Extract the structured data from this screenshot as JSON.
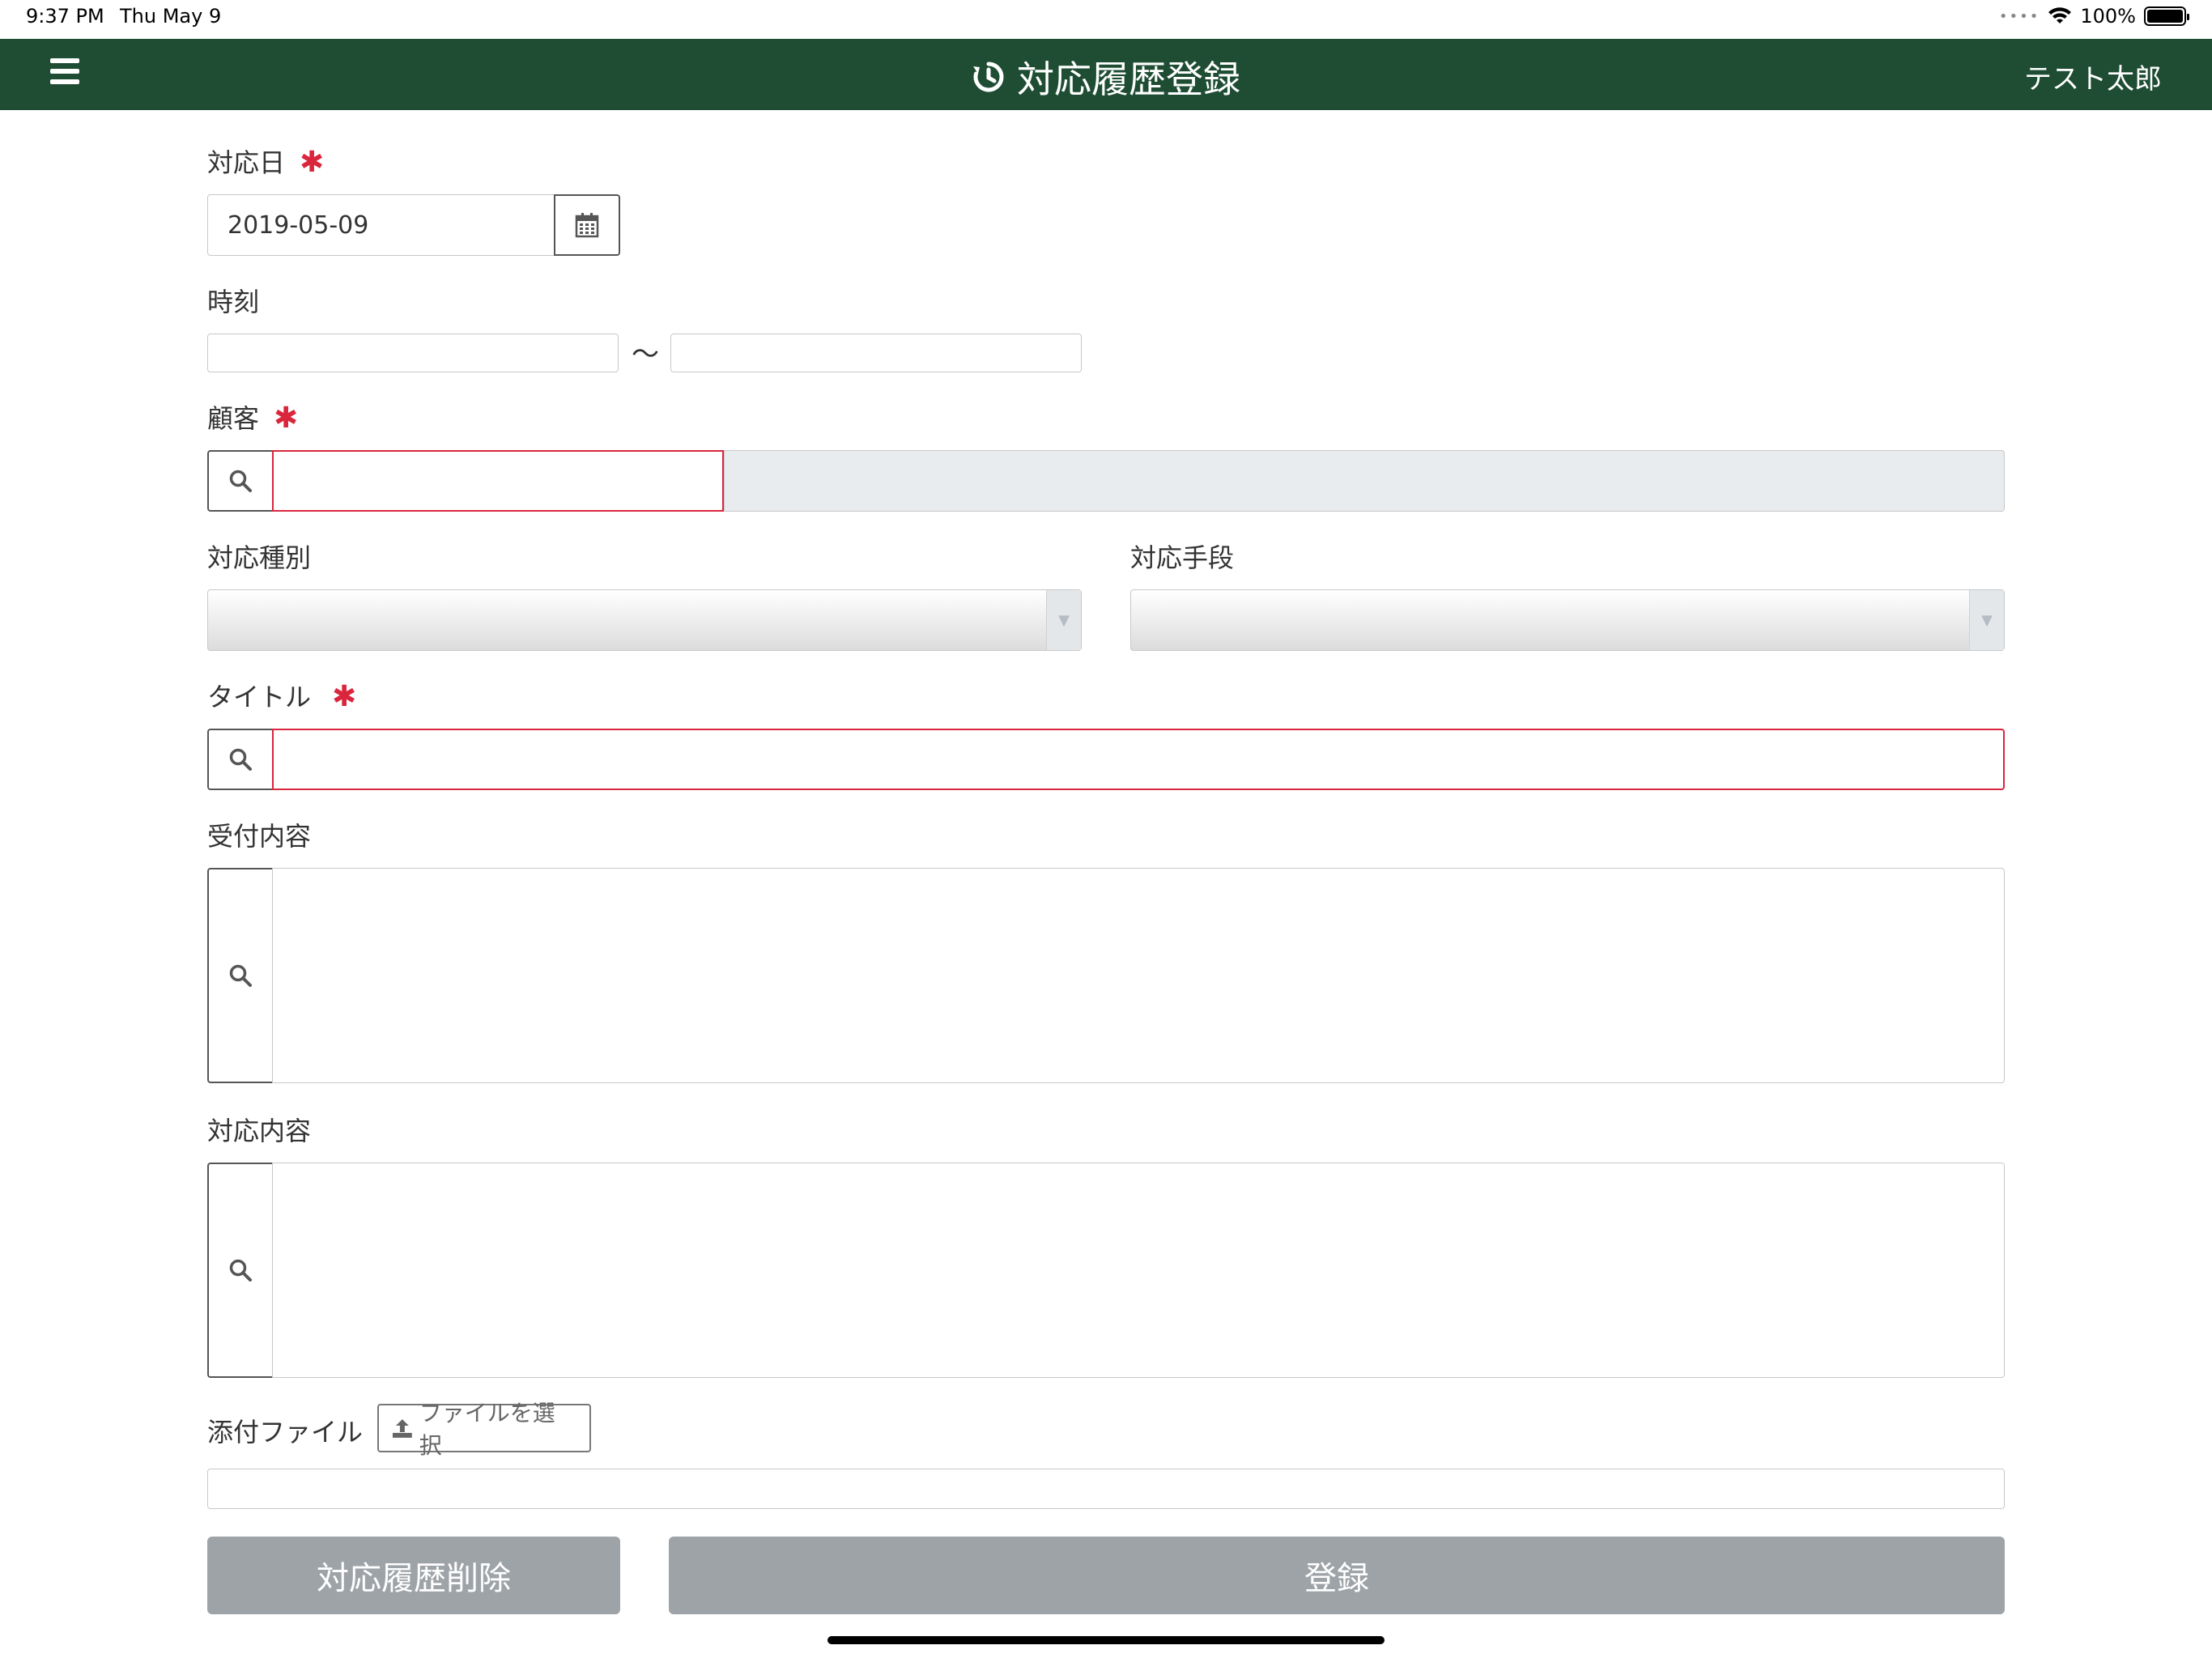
{
  "status_bar": {
    "time": "9:37 PM",
    "date": "Thu May 9",
    "battery": "100%"
  },
  "header": {
    "title": "対応履歴登録",
    "user": "テスト太郎"
  },
  "form": {
    "date_label": "対応日",
    "date_value": "2019-05-09",
    "time_label": "時刻",
    "time_separator": "〜",
    "customer_label": "顧客",
    "type_label": "対応種別",
    "method_label": "対応手段",
    "title_label": "タイトル",
    "reception_label": "受付内容",
    "response_label": "対応内容",
    "attachment_label": "添付ファイル",
    "file_button": "ファイルを選択",
    "required_mark": "✱"
  },
  "buttons": {
    "delete": "対応履歴削除",
    "register": "登録"
  },
  "colors": {
    "header_bg": "#1e4d33",
    "required": "#d9263d",
    "button_bg": "#9ea3a8"
  }
}
